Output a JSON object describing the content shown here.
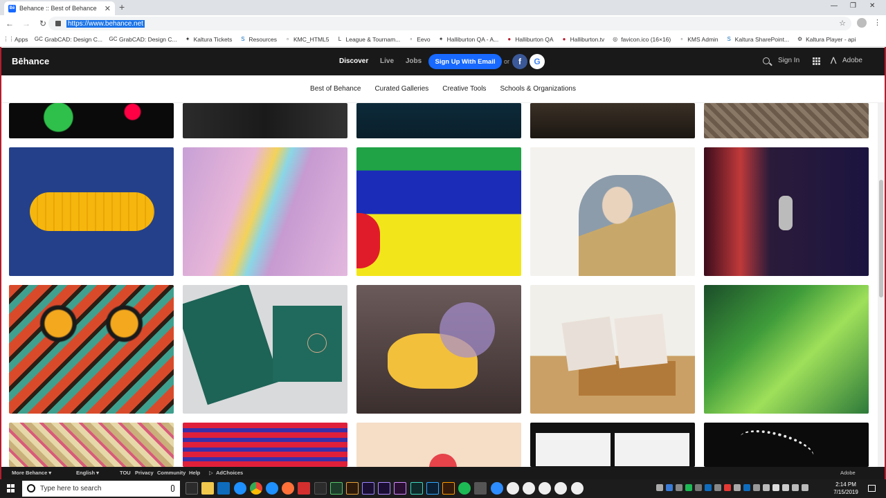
{
  "browser": {
    "tab_title": "Behance :: Best of Behance",
    "tab_favicon_text": "Bē",
    "url": "https://www.behance.net",
    "bookmarks": [
      {
        "label": "Apps",
        "icon": "apps-grid-icon"
      },
      {
        "label": "GrabCAD: Design C...",
        "icon": "grabcad-icon"
      },
      {
        "label": "GrabCAD: Design C...",
        "icon": "grabcad-icon"
      },
      {
        "label": "Kaltura Tickets",
        "icon": "kaltura-icon"
      },
      {
        "label": "Resources",
        "icon": "sharepoint-icon"
      },
      {
        "label": "KMC_HTML5",
        "icon": "page-icon"
      },
      {
        "label": "League & Tournam...",
        "icon": "league-icon"
      },
      {
        "label": "Eevo",
        "icon": "page-icon"
      },
      {
        "label": "Halliburton QA - A...",
        "icon": "kaltura-icon"
      },
      {
        "label": "Halliburton QA",
        "icon": "halliburton-icon"
      },
      {
        "label": "Halliburton.tv",
        "icon": "halliburton-icon"
      },
      {
        "label": "favicon.ico (16×16)",
        "icon": "globe-icon"
      },
      {
        "label": "KMS Admin",
        "icon": "page-icon"
      },
      {
        "label": "Kaltura SharePoint...",
        "icon": "sharepoint-icon"
      },
      {
        "label": "Kaltura Player - api",
        "icon": "gear-icon"
      }
    ]
  },
  "header": {
    "logo": "Bēhance",
    "nav": [
      "Discover",
      "Live",
      "Jobs"
    ],
    "signup_label": "Sign Up With Email",
    "or_label": "or",
    "facebook_label": "f",
    "google_label": "G",
    "signin_label": "Sign In",
    "adobe_label": "Adobe"
  },
  "subnav": [
    "Best of Behance",
    "Curated Galleries",
    "Creative Tools",
    "Schools & Organizations"
  ],
  "footer": {
    "more_behance": "More Behance ▾",
    "language": "English ▾",
    "links": [
      "TOU",
      "Privacy",
      "Community",
      "Help"
    ],
    "adchoices": "AdChoices",
    "adobe": "Adobe"
  },
  "taskbar": {
    "search_placeholder": "Type here to search",
    "time": "2:14 PM",
    "date": "7/15/2019"
  },
  "colors": {
    "accent": "#1769ff",
    "header_bg": "#191919"
  }
}
